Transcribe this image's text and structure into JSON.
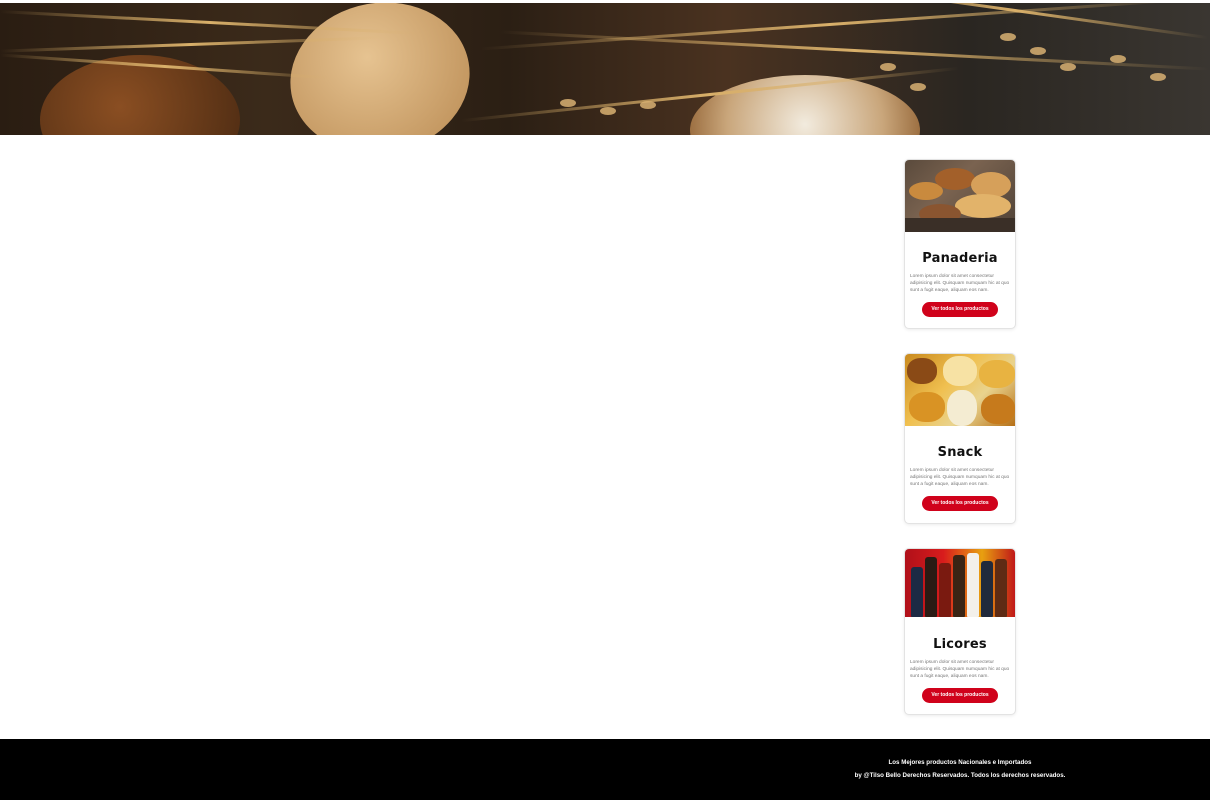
{
  "hero": {
    "image": "bread-and-wheat-banner"
  },
  "categories": [
    {
      "title": "Panaderia",
      "image": "bakery-products-photo",
      "description": "Lorem ipsum dolor sit amet consectetur adipisicing elit. Quisquam numquam hic at quo sunt a fugit eaque, aliquam eos nam.",
      "button_label": "Ver todos los productos"
    },
    {
      "title": "Snack",
      "image": "snacks-photo",
      "description": "Lorem ipsum dolor sit amet consectetur adipisicing elit. Quisquam numquam hic at quo sunt a fugit eaque, aliquam eos nam.",
      "button_label": "Ver todos los productos"
    },
    {
      "title": "Licores",
      "image": "liquor-bottles-photo",
      "description": "Lorem ipsum dolor sit amet consectetur adipisicing elit. Quisquam numquam hic at quo sunt a fugit eaque, aliquam eos nam.",
      "button_label": "Ver todos los productos"
    }
  ],
  "footer": {
    "tagline": "Los Mejores productos Nacionales e Importados",
    "credits": "by @Tilso Bello Derechos Reservados. Todos los derechos reservados."
  },
  "colors": {
    "accent": "#d0021b",
    "footer_bg": "#000000",
    "card_border": "#e3e3e3"
  }
}
